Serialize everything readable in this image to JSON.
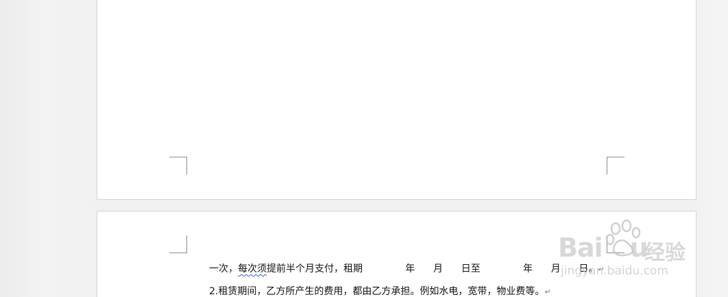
{
  "document": {
    "line1_prefix": "一次，",
    "line1_squiggle": "每次须",
    "line1_rest": "提前半个月支付，租期              年      月      日至              年      月      日。",
    "line1_mark": "↵",
    "line2_text": "2.租赁期间，乙方所产生的费用，都由乙方承担。例如水电，宽带，物业费等。",
    "line2_mark": "↵"
  },
  "watermark": {
    "logo": "Bai",
    "logo_tail": "u",
    "cn": "经验",
    "url": "jingyan.baidu.com"
  },
  "colors": {
    "page": "#ffffff",
    "background": "#f0f0f0",
    "squiggle": "#2d5bd6"
  }
}
